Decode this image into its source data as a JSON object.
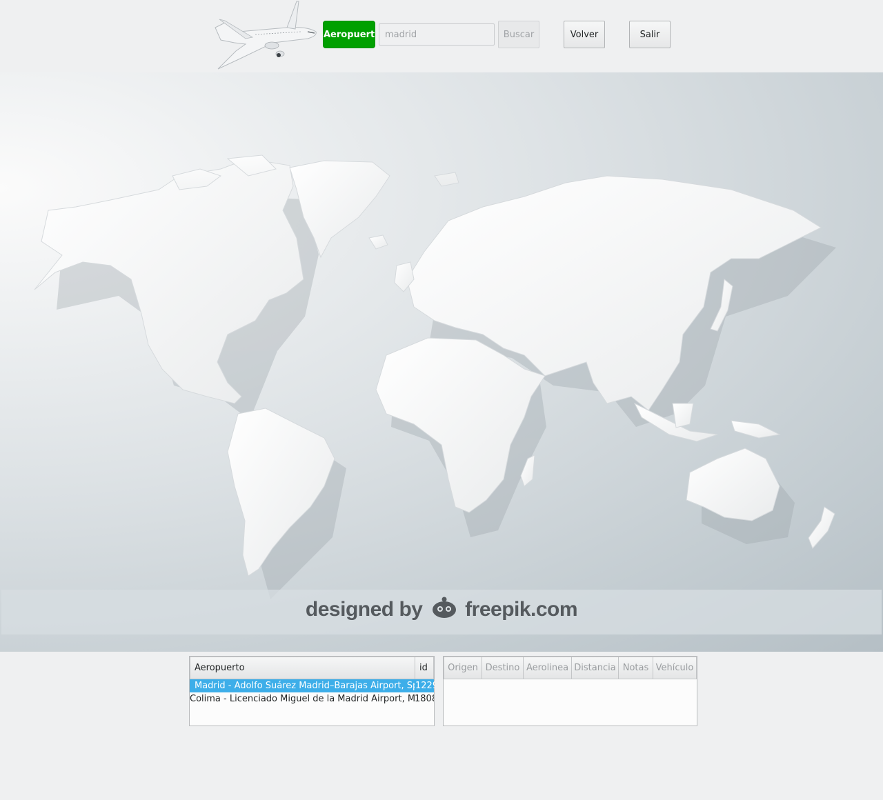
{
  "toolbar": {
    "mode_label": "Aeropuerto",
    "search_value": "madrid",
    "search_label": "Buscar",
    "back_label": "Volver",
    "exit_label": "Salir"
  },
  "map": {
    "credit_text_1": "designed by",
    "credit_text_2": "freepik.com"
  },
  "airports": {
    "columns": [
      "Aeropuerto",
      "id"
    ],
    "rows": [
      {
        "name": "Madrid - Adolfo Suárez Madrid–Barajas Airport, Spain",
        "id": "1229",
        "selected": true
      },
      {
        "name": "Colima - Licenciado Miguel de la Madrid Airport, Mexico",
        "id": "1808",
        "selected": false
      }
    ]
  },
  "routes": {
    "columns": [
      "Origen",
      "Destino",
      "Aerolinea",
      "Distancia",
      "Notas",
      "Vehículo"
    ]
  },
  "colors": {
    "accent_green": "#00a000",
    "selection_blue": "#3daee9",
    "background": "#eff0f1"
  }
}
